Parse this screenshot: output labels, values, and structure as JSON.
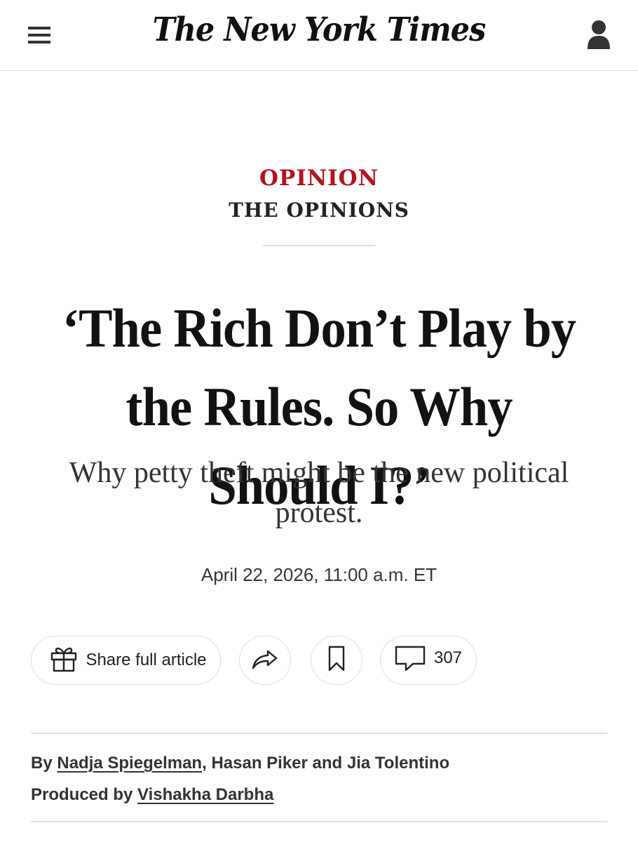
{
  "header": {
    "logo_text": "The New York Times",
    "menu_icon": "hamburger-menu-icon",
    "account_icon": "user-account-icon"
  },
  "kicker": {
    "section": "OPINION",
    "series": "THE OPINIONS"
  },
  "article": {
    "headline": "‘The Rich Don’t Play by the Rules. So Why Should I?’",
    "summary": "Why petty theft might be the new political protest.",
    "dateline": "April 22, 2026, 11:00 a.m. ET"
  },
  "actions": {
    "share_label": "Share full article",
    "share_icon": "gift-icon",
    "forward_icon": "share-arrow-icon",
    "save_icon": "bookmark-icon",
    "comments_icon": "comment-bubble-icon",
    "comments_count": "307"
  },
  "byline": {
    "by_prefix": "By",
    "author_1": "Nadja Spiegelman",
    "separator": ",",
    "author_2": "Hasan Piker",
    "conjunction": "and",
    "author_3": "Jia Tolentino",
    "produced_prefix": "Produced by",
    "producer": "Vishakha Darbha"
  },
  "colors": {
    "opinion_red": "#b4121d",
    "text": "#121212",
    "divider": "#e2e2e2"
  }
}
